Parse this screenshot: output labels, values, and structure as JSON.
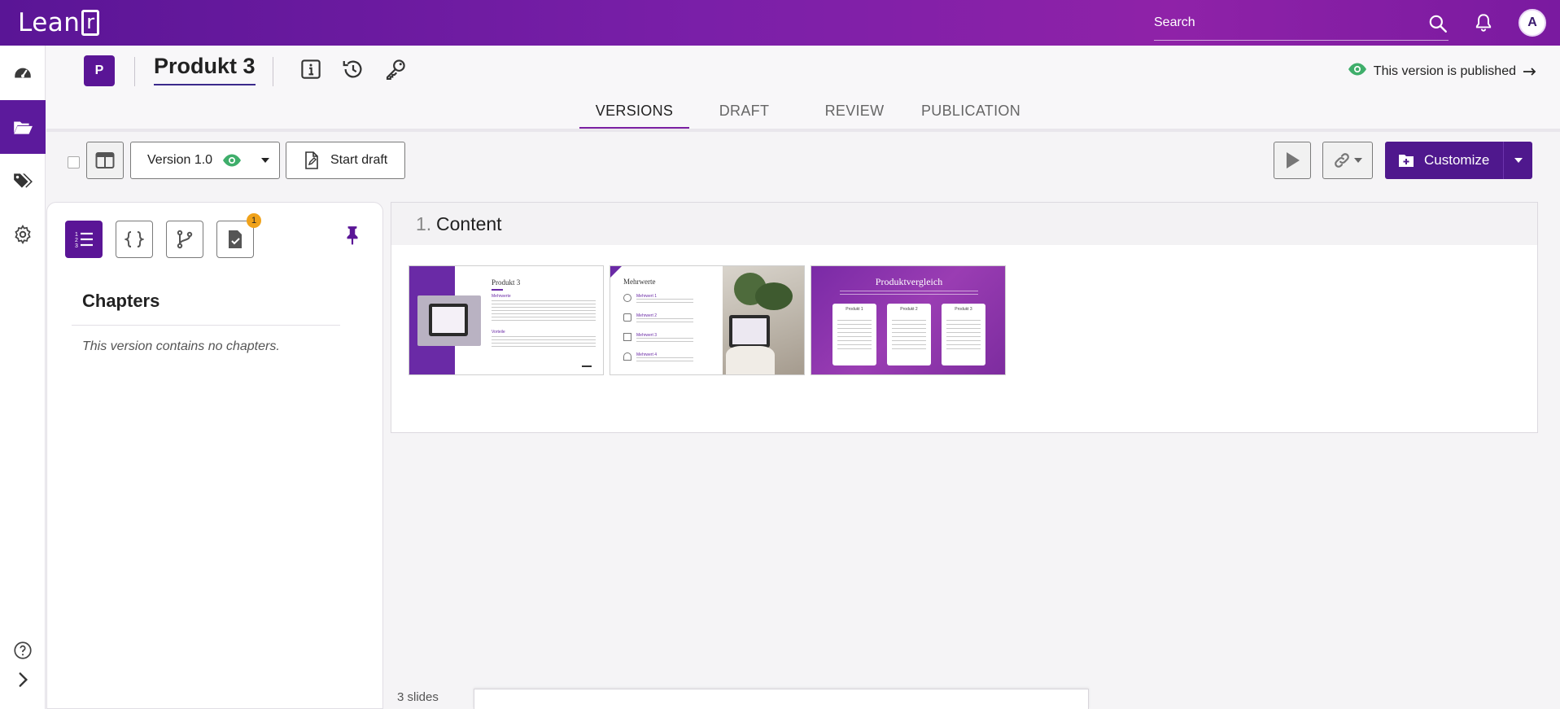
{
  "app": {
    "logo_text": "Lean",
    "logo_r": "r"
  },
  "search": {
    "placeholder": "Search"
  },
  "user": {
    "avatar_initial": "A"
  },
  "rail": [
    "dashboard-icon",
    "folder-icon",
    "tags-icon",
    "settings-icon",
    "help-icon",
    "expand-icon"
  ],
  "project": {
    "badge": "P",
    "title": "Produkt 3"
  },
  "status": {
    "published_text": "This version is published"
  },
  "tabs": [
    {
      "label": "VERSIONS",
      "active": true
    },
    {
      "label": "DRAFT",
      "active": false
    },
    {
      "label": "REVIEW",
      "active": false
    },
    {
      "label": "PUBLICATION",
      "active": false
    }
  ],
  "toolbar": {
    "version_label": "Version 1.0",
    "start_draft_label": "Start draft",
    "customize_label": "Customize"
  },
  "sidepanel": {
    "notification_count": "1",
    "chapters_title": "Chapters",
    "empty_message": "This version contains no chapters."
  },
  "content": {
    "section_number": "1.",
    "section_title": "Content",
    "slides": [
      {
        "title": "Produkt 3",
        "sub1": "Mehrwerte",
        "sub2": "Vorteile"
      },
      {
        "title": "Mehrwerte",
        "items": [
          "Mehrwert 1",
          "Mehrwert 2",
          "Mehrwert 3",
          "Mehrwert 4"
        ]
      },
      {
        "title": "Produktvergleich",
        "columns": [
          "Produkt 1",
          "Produkt 2",
          "Produkt 3"
        ]
      }
    ]
  },
  "footer": {
    "slides_count": "3 slides"
  },
  "colors": {
    "brand": "#5a1596",
    "accent": "#7b1fa2",
    "success": "#3fae6b",
    "badge": "#f0a21a"
  }
}
